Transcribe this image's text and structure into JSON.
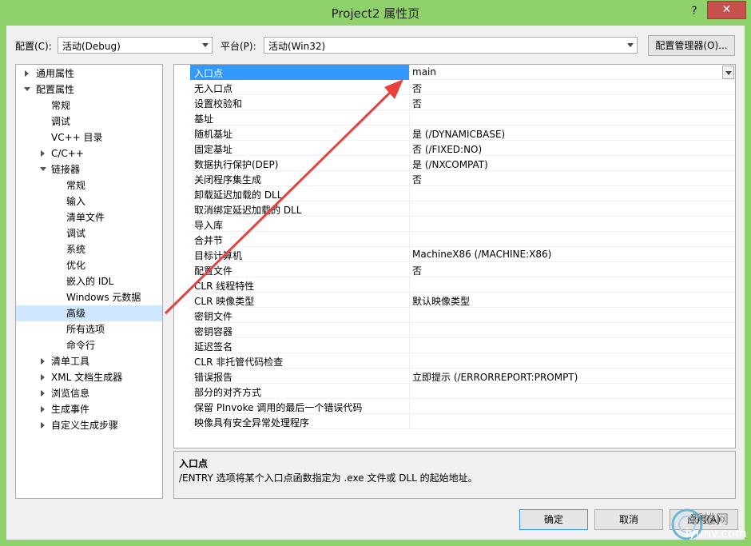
{
  "window": {
    "title": "Project2 属性页",
    "help_label": "?",
    "close_label": "✕"
  },
  "config": {
    "label": "配置(C):",
    "value": "活动(Debug)"
  },
  "platform": {
    "label": "平台(P):",
    "value": "活动(Win32)"
  },
  "config_manager_label": "配置管理器(O)...",
  "tree": [
    {
      "label": "通用属性"
    },
    {
      "label": "配置属性"
    },
    {
      "label": "常规"
    },
    {
      "label": "调试"
    },
    {
      "label": "VC++ 目录"
    },
    {
      "label": "C/C++"
    },
    {
      "label": "链接器"
    },
    {
      "label": "常规"
    },
    {
      "label": "输入"
    },
    {
      "label": "清单文件"
    },
    {
      "label": "调试"
    },
    {
      "label": "系统"
    },
    {
      "label": "优化"
    },
    {
      "label": "嵌入的 IDL"
    },
    {
      "label": "Windows 元数据"
    },
    {
      "label": "高级"
    },
    {
      "label": "所有选项"
    },
    {
      "label": "命令行"
    },
    {
      "label": "清单工具"
    },
    {
      "label": "XML 文档生成器"
    },
    {
      "label": "浏览信息"
    },
    {
      "label": "生成事件"
    },
    {
      "label": "自定义生成步骤"
    }
  ],
  "properties": [
    {
      "name": "入口点",
      "value": "main"
    },
    {
      "name": "无入口点",
      "value": "否"
    },
    {
      "name": "设置校验和",
      "value": "否"
    },
    {
      "name": "基址",
      "value": ""
    },
    {
      "name": "随机基址",
      "value": "是 (/DYNAMICBASE)"
    },
    {
      "name": "固定基址",
      "value": "否 (/FIXED:NO)"
    },
    {
      "name": "数据执行保护(DEP)",
      "value": "是 (/NXCOMPAT)"
    },
    {
      "name": "关闭程序集生成",
      "value": "否"
    },
    {
      "name": "卸载延迟加载的 DLL",
      "value": ""
    },
    {
      "name": "取消绑定延迟加载的 DLL",
      "value": ""
    },
    {
      "name": "导入库",
      "value": ""
    },
    {
      "name": "合并节",
      "value": ""
    },
    {
      "name": "目标计算机",
      "value": "MachineX86 (/MACHINE:X86)"
    },
    {
      "name": "配置文件",
      "value": "否"
    },
    {
      "name": "CLR 线程特性",
      "value": ""
    },
    {
      "name": "CLR 映像类型",
      "value": "默认映像类型"
    },
    {
      "name": "密钥文件",
      "value": ""
    },
    {
      "name": "密钥容器",
      "value": ""
    },
    {
      "name": "延迟签名",
      "value": ""
    },
    {
      "name": "CLR 非托管代码检查",
      "value": ""
    },
    {
      "name": "错误报告",
      "value": "立即提示 (/ERRORREPORT:PROMPT)"
    },
    {
      "name": "部分的对齐方式",
      "value": ""
    },
    {
      "name": "保留 PInvoke 调用的最后一个错误代码",
      "value": ""
    },
    {
      "name": "映像具有安全异常处理程序",
      "value": ""
    }
  ],
  "description": {
    "title": "入口点",
    "text": "/ENTRY 选项将某个入口点函数指定为 .exe 文件或 DLL 的起始地址。"
  },
  "buttons": {
    "ok": "确定",
    "cancel": "取消",
    "apply": "应用(A)"
  },
  "watermark": {
    "line1": "新雄网",
    "line2": "iyunv.com"
  },
  "colors": {
    "frame": "#8fd16b",
    "selection": "#3399ff",
    "tree_selection": "#cde8ff",
    "close": "#c7504c",
    "arrow": "#e8413c"
  }
}
